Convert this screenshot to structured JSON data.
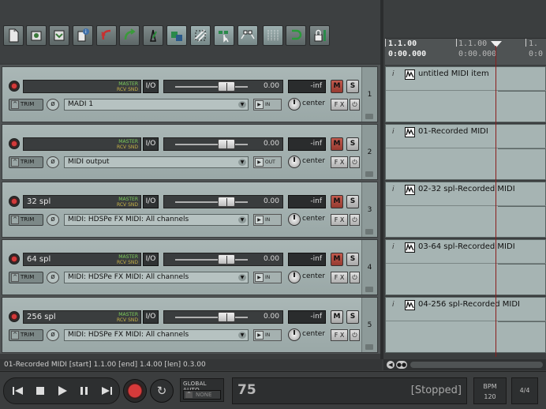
{
  "toolbar": {
    "buttons": [
      {
        "name": "new-project-icon"
      },
      {
        "name": "open-project-icon"
      },
      {
        "name": "save-project-icon"
      },
      {
        "name": "project-settings-icon"
      },
      {
        "name": "undo-icon"
      },
      {
        "name": "redo-icon"
      },
      {
        "name": "metronome-icon"
      },
      {
        "name": "auto-crossfade-icon"
      },
      {
        "name": "item-grouping-icon"
      },
      {
        "name": "ripple-edit-icon"
      },
      {
        "name": "envelope-points-icon"
      },
      {
        "name": "grid-icon"
      },
      {
        "name": "snap-icon"
      },
      {
        "name": "lock-icon"
      }
    ]
  },
  "tracks": [
    {
      "number": "1",
      "name": "",
      "input": "MADI 1",
      "volume": "0.00",
      "peak": "-inf",
      "pan": "center",
      "route": "IN",
      "muted": true,
      "master": "MASTER",
      "rcv": "RCV SND",
      "io": "I/O",
      "trim": "TRIM",
      "fx": "F X",
      "mute": "M",
      "solo": "S"
    },
    {
      "number": "2",
      "name": "",
      "input": "MIDI output",
      "volume": "0.00",
      "peak": "-inf",
      "pan": "center",
      "route": "OUT",
      "muted": true,
      "master": "MASTER",
      "rcv": "RCV SND",
      "io": "I/O",
      "trim": "TRIM",
      "fx": "F X",
      "mute": "M",
      "solo": "S"
    },
    {
      "number": "3",
      "name": "32 spl",
      "input": "MIDI: HDSPe FX MIDI: All channels",
      "volume": "0.00",
      "peak": "-inf",
      "pan": "center",
      "route": "IN",
      "muted": true,
      "master": "MASTER",
      "rcv": "RCV SND",
      "io": "I/O",
      "trim": "TRIM",
      "fx": "F X",
      "mute": "M",
      "solo": "S"
    },
    {
      "number": "4",
      "name": "64 spl",
      "input": "MIDI: HDSPe FX MIDI: All channels",
      "volume": "0.00",
      "peak": "-inf",
      "pan": "center",
      "route": "IN",
      "muted": true,
      "master": "MASTER",
      "rcv": "RCV SND",
      "io": "I/O",
      "trim": "TRIM",
      "fx": "F X",
      "mute": "M",
      "solo": "S"
    },
    {
      "number": "5",
      "name": "256 spl",
      "input": "MIDI: HDSPe FX MIDI: All channels",
      "volume": "0.00",
      "peak": "-inf",
      "pan": "center",
      "route": "IN",
      "muted": false,
      "master": "MASTER",
      "rcv": "RCV SND",
      "io": "I/O",
      "trim": "TRIM",
      "fx": "F X",
      "mute": "M",
      "solo": "S"
    }
  ],
  "ruler": {
    "measure1": "1.1.00",
    "time1": "0:00.000",
    "measure2": "1.1.00",
    "time2": "0:00.000",
    "measure3": "1.",
    "time3": "0:0"
  },
  "items": [
    {
      "label": "untitled MIDI item",
      "info": "i"
    },
    {
      "label": "01-Recorded MIDI",
      "info": "i"
    },
    {
      "label": "02-32 spl-Recorded MIDI",
      "info": "i"
    },
    {
      "label": "03-64 spl-Recorded MIDI",
      "info": "i"
    },
    {
      "label": "04-256 spl-Recorded MIDI",
      "info": "i"
    }
  ],
  "status": "01-Recorded MIDI [start] 1.1.00 [end] 1.4.00 [len] 0.3.00",
  "transport": {
    "global_auto": "GLOBAL AUTO",
    "auto_mode": "NONE",
    "position": "75",
    "state": "[Stopped]",
    "bpm_label": "BPM",
    "bpm": "120",
    "time_sig": "4/4"
  },
  "colors": {
    "mute_active": "#c25a4e",
    "record": "#d63a3a",
    "playhead": "#8a1d1d"
  }
}
